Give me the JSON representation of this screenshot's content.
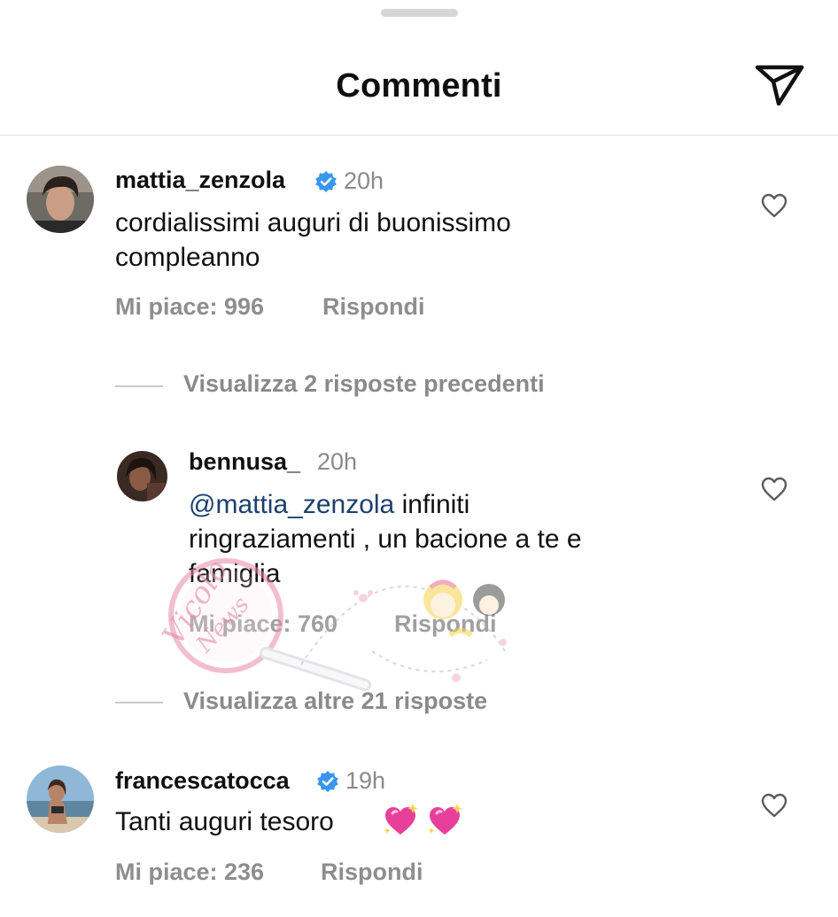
{
  "header": {
    "title": "Commenti",
    "share_icon": "send-icon"
  },
  "comments": [
    {
      "username": "mattia_zenzola",
      "verified": true,
      "time": "20h",
      "text_lines": [
        "cordialissimi auguri di buonissimo",
        "compleanno"
      ],
      "likes": "Mi piace: 996",
      "reply": "Rispondi",
      "view_replies": "Visualizza 2 risposte precedenti"
    },
    {
      "username": "bennusa_",
      "verified": false,
      "time": "20h",
      "mention": "@mattia_zenzola",
      "text_lines": [
        "infiniti",
        "ringraziamenti , un bacione a te e",
        "famiglia"
      ],
      "likes": "Mi piace: 760",
      "reply": "Rispondi",
      "view_replies": "Visualizza altre 21 risposte"
    },
    {
      "username": "francescatocca",
      "verified": true,
      "time": "19h",
      "text_lines": [
        "Tanti auguri tesoro"
      ],
      "emoji": [
        "sparkling-heart",
        "sparkling-heart"
      ],
      "likes": "Mi piace: 236",
      "reply": "Rispondi"
    }
  ],
  "watermark": {
    "line1": "Vicolo",
    "line2": "News"
  },
  "colors": {
    "verified": "#3897f0",
    "mention": "#1d3f6e",
    "muted": "#8e8e8e",
    "heart_emoji": "#e8409a"
  }
}
